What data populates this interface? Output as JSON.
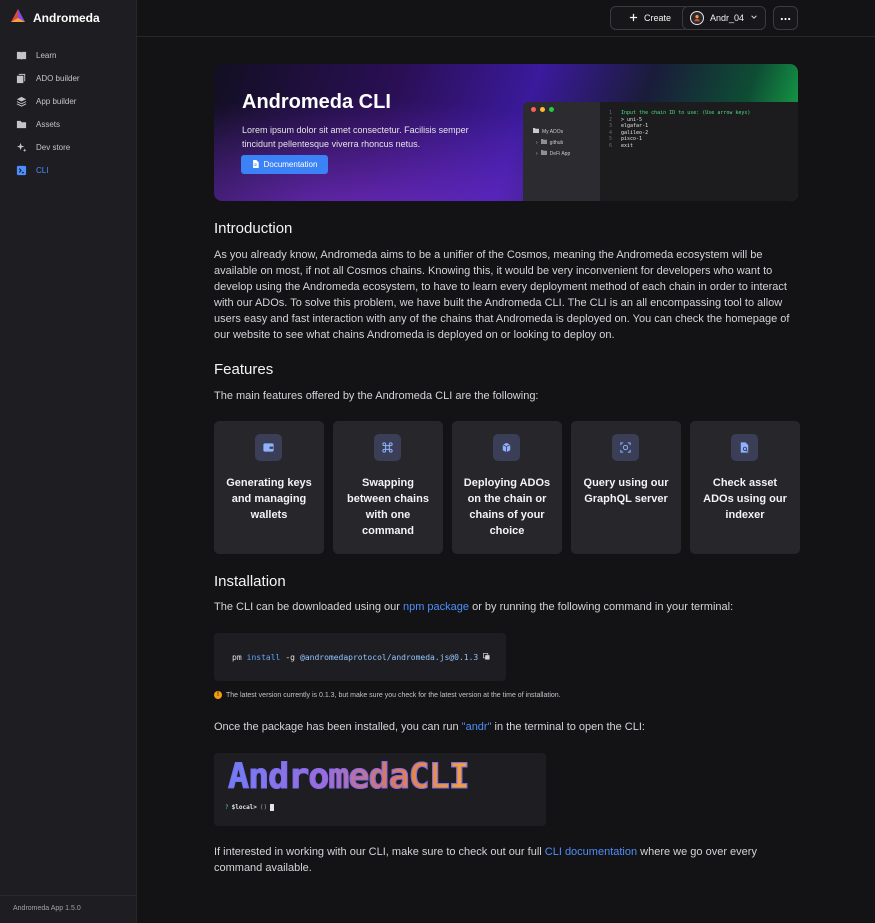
{
  "sidebar": {
    "brand": "Andromeda",
    "items": [
      {
        "label": "Learn",
        "icon": "book-icon"
      },
      {
        "label": "ADO builder",
        "icon": "cube-icon"
      },
      {
        "label": "App builder",
        "icon": "layers-icon"
      },
      {
        "label": "Assets",
        "icon": "folder-icon"
      },
      {
        "label": "Dev store",
        "icon": "sparkle-icon"
      },
      {
        "label": "CLI",
        "icon": "terminal-icon",
        "active": true
      }
    ],
    "version": "Andromeda App 1.5.0"
  },
  "topbar": {
    "create_label": "Create",
    "user_label": "Andr_04"
  },
  "hero": {
    "title": "Andromeda CLI",
    "description": "Lorem ipsum dolor sit amet consectetur. Facilisis semper tincidunt pellentesque viverra rhoncus netus.",
    "button_label": "Documentation",
    "terminal": {
      "folder_root": "My ADOs",
      "folders": [
        "github",
        "DeFi App"
      ],
      "lines": [
        {
          "n": "1",
          "text": "Input the chain ID to use: (Use arrow keys)"
        },
        {
          "n": "2",
          "text": "> uni-5"
        },
        {
          "n": "3",
          "text": "elgafar-1"
        },
        {
          "n": "4",
          "text": "galileo-2"
        },
        {
          "n": "5",
          "text": "pisco-1"
        },
        {
          "n": "6",
          "text": "exit"
        }
      ]
    }
  },
  "intro": {
    "heading": "Introduction",
    "text": "As you already know, Andromeda aims to be a unifier of the Cosmos, meaning the Andromeda ecosystem will be available on most, if not all Cosmos chains. Knowing this, it would be very inconvenient for developers who want to develop using the Andromeda ecosystem, to have to learn every deployment method of each chain in order to interact with our ADOs. To solve this problem, we have built the Andromeda CLI. The CLI is an all encompassing tool to allow users easy and fast interaction with any of the chains that Andromeda is deployed on. You can check the homepage of our website to see what chains Andromeda is deployed on or looking to deploy on."
  },
  "features": {
    "heading": "Features",
    "text": "The main features offered by the Andromeda CLI are the following:",
    "cards": [
      {
        "label": "Generating keys and managing wallets",
        "icon": "wallet-icon"
      },
      {
        "label": "Swapping between chains with one command",
        "icon": "command-icon"
      },
      {
        "label": "Deploying ADOs on the chain or chains of your choice",
        "icon": "box-icon"
      },
      {
        "label": "Query using our GraphQL server",
        "icon": "scan-icon"
      },
      {
        "label": "Check asset ADOs using our indexer",
        "icon": "file-search-icon"
      }
    ]
  },
  "installation": {
    "heading": "Installation",
    "text_before": "The CLI can be downloaded using our ",
    "link_npm": "npm package",
    "text_after": " or by running the following command in your terminal:",
    "cmd_prefix": "pm",
    "cmd_keyword": "install",
    "cmd_flag": "-g",
    "cmd_package": "@andromedaprotocol/andromeda.js@0.1.3",
    "note": "The latest version currently is 0.1.3, but make sure you check for the latest version at the time of installation.",
    "once_before": "Once the package has been installed, you can run ",
    "once_link": "\"andr\"",
    "once_after": " in the terminal to open the CLI:",
    "ascii_title": "AndromedaCLI",
    "prompt_q": "?",
    "prompt_text": "$local>",
    "prompt_parens": "()"
  },
  "footer_text": {
    "before": "If interested in working with our CLI, make sure to check out our full ",
    "link": "CLI documentation",
    "after": " where we go over every command available."
  }
}
